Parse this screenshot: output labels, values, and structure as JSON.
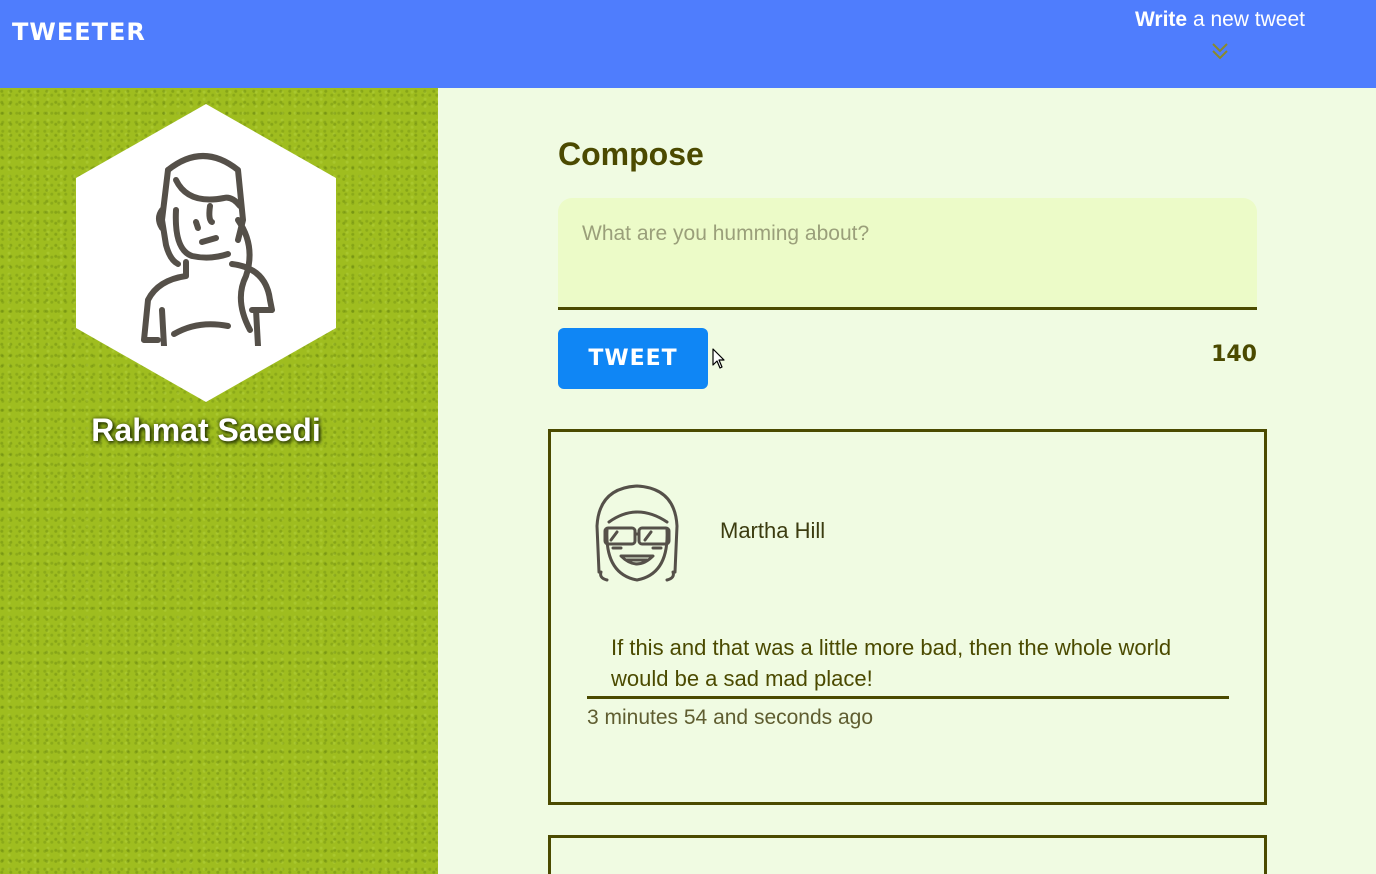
{
  "header": {
    "logo": "TWEETER",
    "write_bold": "Write",
    "write_rest": "a new tweet",
    "toggle_icon": "double-chevron-down-icon"
  },
  "profile": {
    "name": "Rahmat Saeedi",
    "avatar_icon": "woman-avatar-icon"
  },
  "compose": {
    "title": "Compose",
    "placeholder": "What are you humming about?",
    "value": "",
    "button_label": "TWEET",
    "char_count": "140"
  },
  "tweets": [
    {
      "author": "Martha Hill",
      "avatar_icon": "girl-with-sunglasses-avatar-icon",
      "text": "If this and that was a little more bad, then the whole world would be a sad mad place!",
      "time": "3 minutes 54 and seconds ago"
    }
  ],
  "colors": {
    "nav": "#4f7dfd",
    "sidebar": "#9fbd1f",
    "main_bg": "#f0fbe2",
    "accent_dark": "#4b4a00",
    "button": "#0f86f5"
  }
}
